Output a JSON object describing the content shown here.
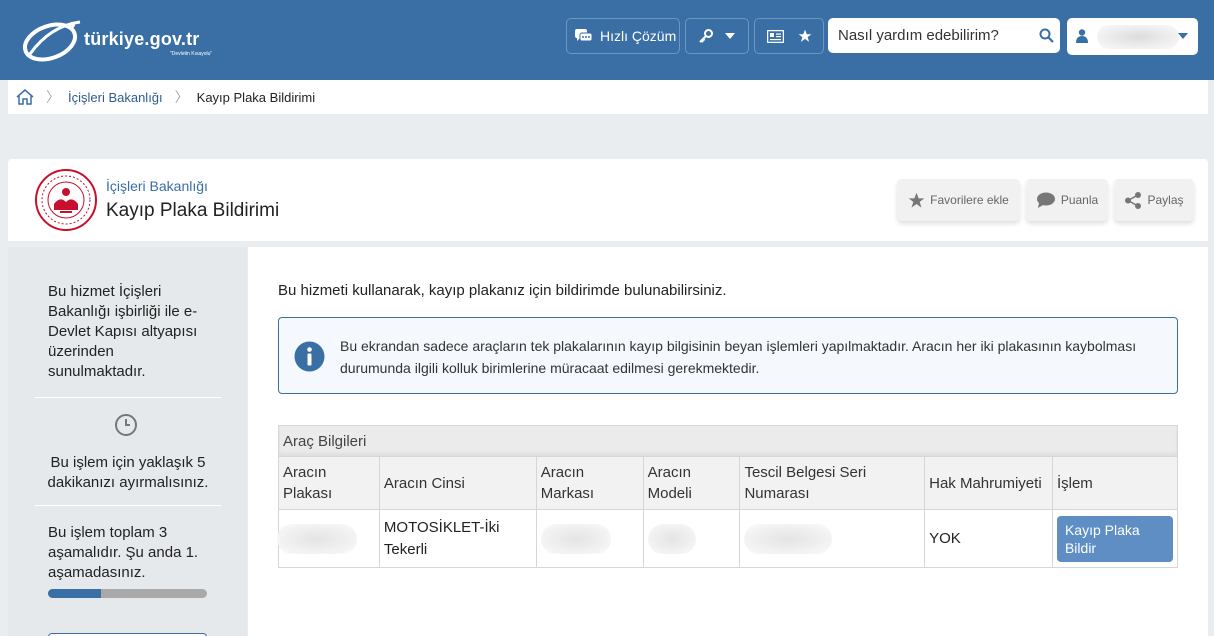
{
  "header": {
    "logo_text": "türkiye.gov.tr",
    "logo_tagline": "\"Devletin Kısayolu\"",
    "quick_solution_label": "Hızlı Çözüm",
    "search_placeholder": "Nasıl yardım edebilirim?",
    "brand_color": "#3a6fa5"
  },
  "breadcrumb": {
    "items": [
      "İçişleri Bakanlığı",
      "Kayıp Plaka Bildirimi"
    ]
  },
  "service": {
    "ministry": "İçişleri Bakanlığı",
    "title": "Kayıp Plaka Bildirimi",
    "favorite_label": "Favorilere ekle",
    "rate_label": "Puanla",
    "share_label": "Paylaş"
  },
  "sidebar": {
    "cooperation_text": "Bu hizmet İçişleri Bakanlığı işbirliği ile e-Devlet Kapısı altyapısı üzerinden sunulmaktadır.",
    "duration_text": "Bu işlem için yaklaşık 5 dakikanızı ayırmalısınız.",
    "step_text": "Bu işlem toplam 3 aşamalıdır. Şu anda 1. aşamadasınız.",
    "progress": 0.333
  },
  "main": {
    "intro": "Bu hizmeti kullanarak, kayıp plakanız için bildirimde bulunabilirsiniz.",
    "info_text": "Bu ekrandan sadece araçların tek plakalarının kayıp bilgisinin beyan işlemleri yapılmaktadır. Aracın her iki plakasının kaybolması durumunda ilgili kolluk birimlerine müracaat edilmesi gerekmektedir.",
    "table": {
      "caption": "Araç Bilgileri",
      "headers": [
        "Aracın Plakası",
        "Aracın Cinsi",
        "Aracın Markası",
        "Aracın Modeli",
        "Tescil Belgesi Seri Numarası",
        "Hak Mahrumiyeti",
        "İşlem"
      ],
      "row": {
        "type": "MOTOSİKLET-İki Tekerli",
        "deprivation": "YOK",
        "action_label": "Kayıp Plaka Bildir"
      }
    }
  }
}
